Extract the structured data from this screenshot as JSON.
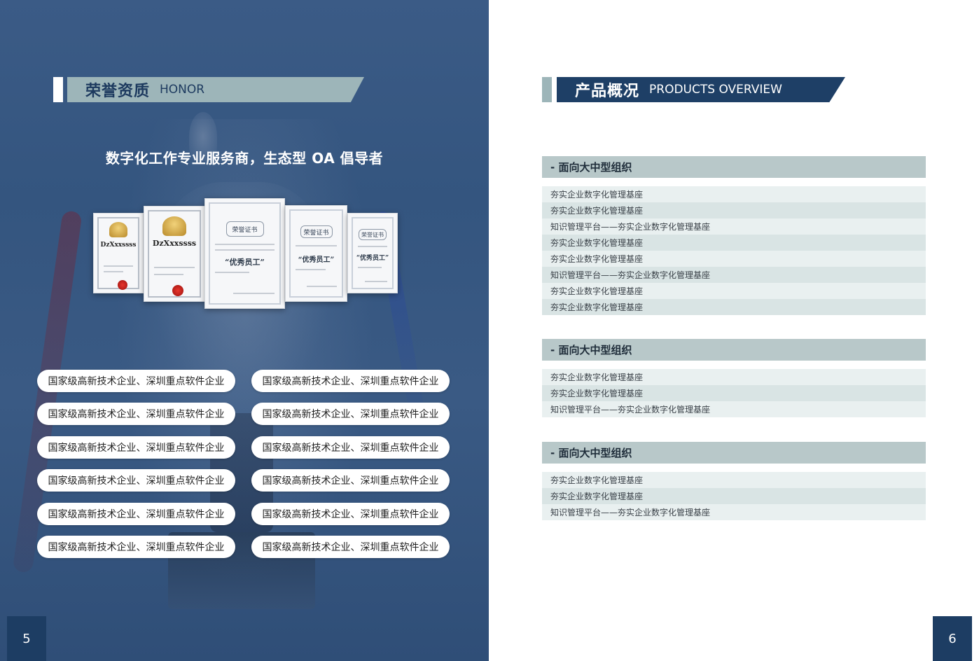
{
  "left_page": {
    "header": {
      "title_cn": "荣誉资质",
      "title_en": "HONOR"
    },
    "slogan": "数字化工作专业服务商，生态型 OA 倡导者",
    "certificates": [
      {
        "name": "DzXxxssss"
      },
      {
        "name": "DzXxxssss"
      },
      {
        "stamp": "荣誉证书",
        "title": "“优秀员工”"
      },
      {
        "stamp": "荣誉证书",
        "title": "“优秀员工”"
      },
      {
        "stamp": "荣誉证书",
        "title": "“优秀员工”"
      }
    ],
    "honors": [
      "国家级高新技术企业、深圳重点软件企业",
      "国家级高新技术企业、深圳重点软件企业",
      "国家级高新技术企业、深圳重点软件企业",
      "国家级高新技术企业、深圳重点软件企业",
      "国家级高新技术企业、深圳重点软件企业",
      "国家级高新技术企业、深圳重点软件企业",
      "国家级高新技术企业、深圳重点软件企业",
      "国家级高新技术企业、深圳重点软件企业",
      "国家级高新技术企业、深圳重点软件企业",
      "国家级高新技术企业、深圳重点软件企业",
      "国家级高新技术企业、深圳重点软件企业",
      "国家级高新技术企业、深圳重点软件企业"
    ],
    "page_number": "5"
  },
  "right_page": {
    "header": {
      "title_cn": "产品概况",
      "title_en": "PRODUCTS OVERVIEW"
    },
    "groups": [
      {
        "title": "- 面向大中型组织",
        "rows": [
          "夯实企业数字化管理基座",
          "夯实企业数字化管理基座",
          "知识管理平台——夯实企业数字化管理基座",
          "夯实企业数字化管理基座",
          "夯实企业数字化管理基座",
          "知识管理平台——夯实企业数字化管理基座",
          "夯实企业数字化管理基座",
          "夯实企业数字化管理基座"
        ]
      },
      {
        "title": "- 面向大中型组织",
        "rows": [
          "夯实企业数字化管理基座",
          "夯实企业数字化管理基座",
          "知识管理平台——夯实企业数字化管理基座"
        ]
      },
      {
        "title": "- 面向大中型组织",
        "rows": [
          "夯实企业数字化管理基座",
          "夯实企业数字化管理基座",
          "知识管理平台——夯实企业数字化管理基座"
        ]
      }
    ],
    "page_number": "6"
  },
  "colors": {
    "navy": "#1e3f66",
    "sage": "#9db5b9",
    "page_blue": "#3b5b86"
  }
}
